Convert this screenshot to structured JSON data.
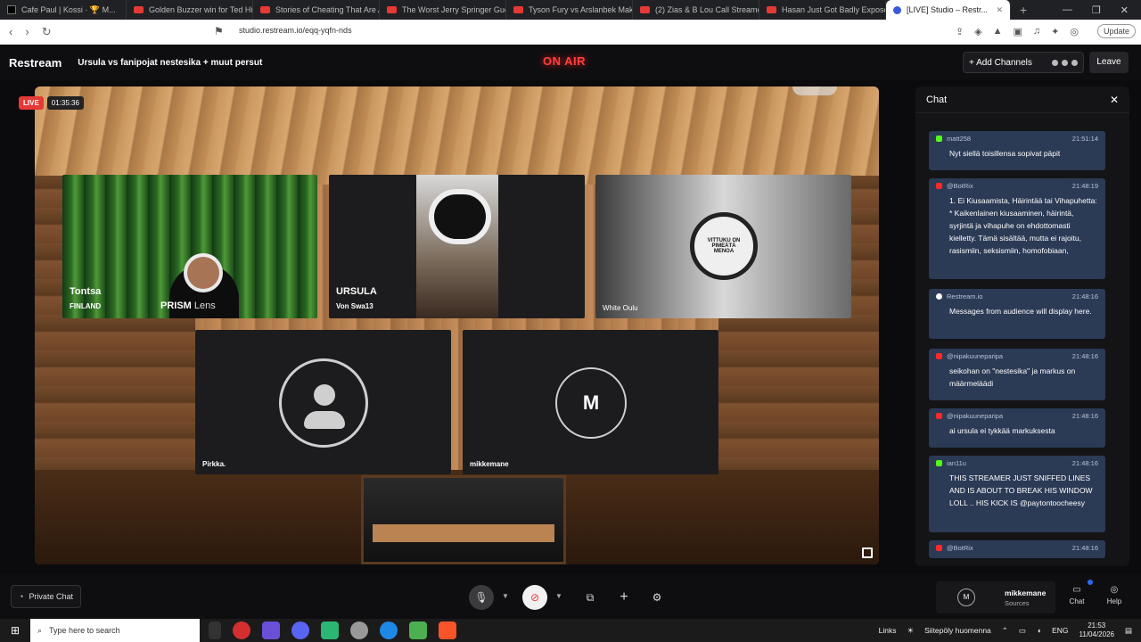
{
  "browser": {
    "tabs": [
      {
        "label": "Cafe Paul | Kossi · 🏆 M..."
      },
      {
        "label": "Golden Buzzer win for Ted Hill"
      },
      {
        "label": "Stories of Cheating That Are Al..."
      },
      {
        "label": "The Worst Jerry Springer Guest"
      },
      {
        "label": "Tyson Fury vs Arslanbek Makhm..."
      },
      {
        "label": "(2) Zias & B Lou Call Streamer..."
      },
      {
        "label": "Hasan Just Got Badly Exposed"
      },
      {
        "label": "[LIVE] Studio – Restr..."
      }
    ],
    "url": "studio.restream.io/eqq-yqfn-nds",
    "update_label": "Update"
  },
  "app": {
    "brand": "Restream",
    "stream_title": "Ursula vs fanipojat nestesika + muut persut",
    "on_air": "ON AIR",
    "add_channels": "+ Add Channels",
    "leave": "Leave"
  },
  "stage": {
    "live_label": "LIVE",
    "timer": "01:35:36",
    "tiles": [
      {
        "name": "Tontsa",
        "sub": "FINLAND",
        "overlay": "PRISM",
        "overlay_b": "Lens"
      },
      {
        "name": "URSULA",
        "sub": "Von Swa13"
      },
      {
        "name": "White Oulu",
        "badge": "VITTUKU ON PIMEÄTÄ MENOA"
      },
      {
        "name": "Pirkka."
      },
      {
        "name": "mikkemane",
        "initial": "M"
      }
    ]
  },
  "chat": {
    "title": "Chat",
    "messages": [
      {
        "platform": "kick",
        "user": "matt258",
        "time": "21:51:14",
        "text": "Nyt siellä toisillensa sopivat päpit"
      },
      {
        "platform": "youtube",
        "user": "@BotRix",
        "time": "21:48:19",
        "text": "1. Ei Kiusaamista, Häirintää tai Vihapuhetta: * Kaikenlainen kiusaaminen, häirintä, syrjintä ja vihapuhe on ehdottomasti kielletty. Tämä sisältää, mutta ei rajoitu, rasismiin, seksismiin, homofobiaan,"
      },
      {
        "platform": "restream",
        "user": "Restream.io",
        "time": "21:48:16",
        "text": "Messages from audience will display here."
      },
      {
        "platform": "youtube",
        "user": "@nipakuuneparipa",
        "time": "21:48:16",
        "text": "seikohan on \"nestesika\" ja markus on määrmeläädi"
      },
      {
        "platform": "youtube",
        "user": "@nipakuuneparipa",
        "time": "21:48:16",
        "text": "ai ursula ei tykkää markuksesta"
      },
      {
        "platform": "kick",
        "user": "ian11u",
        "time": "21:48:16",
        "text": "THIS STREAMER JUST SNIFFED LINES AND IS ABOUT TO BREAK HIS WINDOW LOLL .. HIS KICK IS @paytontoocheesy"
      },
      {
        "platform": "youtube",
        "user": "@BotRix",
        "time": "21:48:16",
        "text": ""
      }
    ]
  },
  "controls": {
    "private_chat": "Private Chat",
    "me_name": "mikkemane",
    "me_sub": "Sources",
    "me_initial": "M",
    "chat_label": "Chat",
    "help_label": "Help"
  },
  "taskbar": {
    "search_placeholder": "Type here to search",
    "links": "Links",
    "weather": "Siitepöly huomenna",
    "lang": "ENG",
    "time": "21:53",
    "date": "11/04/2026"
  }
}
